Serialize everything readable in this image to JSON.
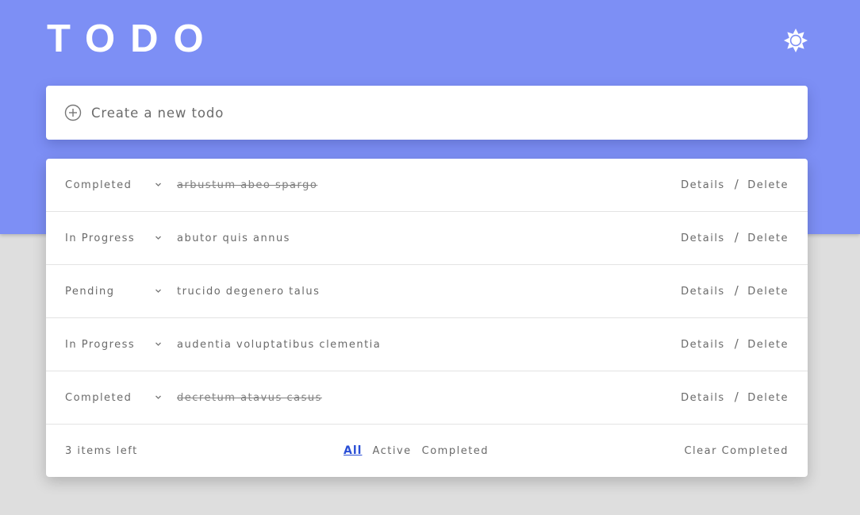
{
  "header": {
    "title": "TODO",
    "theme_toggle_icon": "sun-icon"
  },
  "create": {
    "placeholder": "Create a new todo",
    "add_icon": "plus-circle-icon"
  },
  "todos": [
    {
      "status": "Completed",
      "text": "arbustum abeo spargo",
      "done": true
    },
    {
      "status": "In Progress",
      "text": "abutor quis annus",
      "done": false
    },
    {
      "status": "Pending",
      "text": "trucido degenero talus",
      "done": false
    },
    {
      "status": "In Progress",
      "text": "audentia voluptatibus clementia",
      "done": false
    },
    {
      "status": "Completed",
      "text": "decretum atavus casus",
      "done": true
    }
  ],
  "row_actions": {
    "details_label": "Details",
    "separator": "/",
    "delete_label": "Delete"
  },
  "footer": {
    "items_left": "3 items left",
    "filters": [
      "All",
      "Active",
      "Completed"
    ],
    "active_filter": "All",
    "clear_label": "Clear Completed"
  },
  "colors": {
    "header_bg": "#7d8ff5",
    "page_bg": "#dedede",
    "active_filter": "#2a4fd6"
  }
}
